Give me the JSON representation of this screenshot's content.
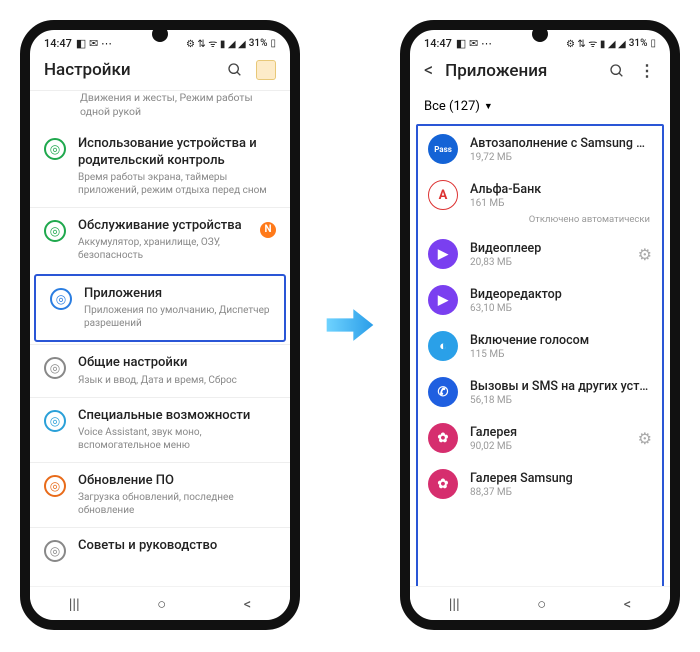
{
  "status": {
    "time": "14:47",
    "battery": "31%"
  },
  "left": {
    "title": "Настройки",
    "truncated_sub": "Движения и жесты, Режим работы одной рукой",
    "items": [
      {
        "title": "Использование устройства и родительский контроль",
        "sub": "Время работы экрана, таймеры приложений, режим отдыха перед сном",
        "color": "#1fa84d"
      },
      {
        "title": "Обслуживание устройства",
        "sub": "Аккумулятор, хранилище, ОЗУ, безопасность",
        "color": "#1fa84d",
        "badge": "N"
      },
      {
        "title": "Приложения",
        "sub": "Приложения по умолчанию, Диспетчер разрешений",
        "color": "#2a7de1",
        "highlight": true
      },
      {
        "title": "Общие настройки",
        "sub": "Язык и ввод, Дата и время, Сброс",
        "color": "#888"
      },
      {
        "title": "Специальные возможности",
        "sub": "Voice Assistant, звук моно, вспомогательное меню",
        "color": "#2aa0d8"
      },
      {
        "title": "Обновление ПО",
        "sub": "Загрузка обновлений, последнее обновление",
        "color": "#e86b1a"
      },
      {
        "title": "Советы и руководство",
        "sub": "",
        "color": "#888"
      }
    ]
  },
  "right": {
    "title": "Приложения",
    "filter": "Все (127)",
    "apps": [
      {
        "title": "Автозаполнение с Samsung Pas..",
        "sub": "19,72 МБ",
        "bg": "#1463d6",
        "glyph": "Pass"
      },
      {
        "title": "Альфа-Банк",
        "sub": "161 МБ",
        "bg": "#ffffff",
        "glyph": "А",
        "border": "#d33",
        "fg": "#d33",
        "note": "Отключено автоматически"
      },
      {
        "title": "Видеоплеер",
        "sub": "20,83 МБ",
        "bg": "#7a3ff0",
        "glyph": "▶",
        "gear": true
      },
      {
        "title": "Видеоредактор",
        "sub": "63,10 МБ",
        "bg": "#7a3ff0",
        "glyph": "▶"
      },
      {
        "title": "Включение голосом",
        "sub": "115 МБ",
        "bg": "#2aa0e8",
        "glyph": "◐"
      },
      {
        "title": "Вызовы и SMS на других устро..",
        "sub": "56,18 МБ",
        "bg": "#1f5fe0",
        "glyph": "✆"
      },
      {
        "title": "Галерея",
        "sub": "90,02 МБ",
        "bg": "#d62e6e",
        "glyph": "✿",
        "gear": true
      },
      {
        "title": "Галерея Samsung",
        "sub": "88,37 МБ",
        "bg": "#d62e6e",
        "glyph": "✿"
      }
    ]
  }
}
